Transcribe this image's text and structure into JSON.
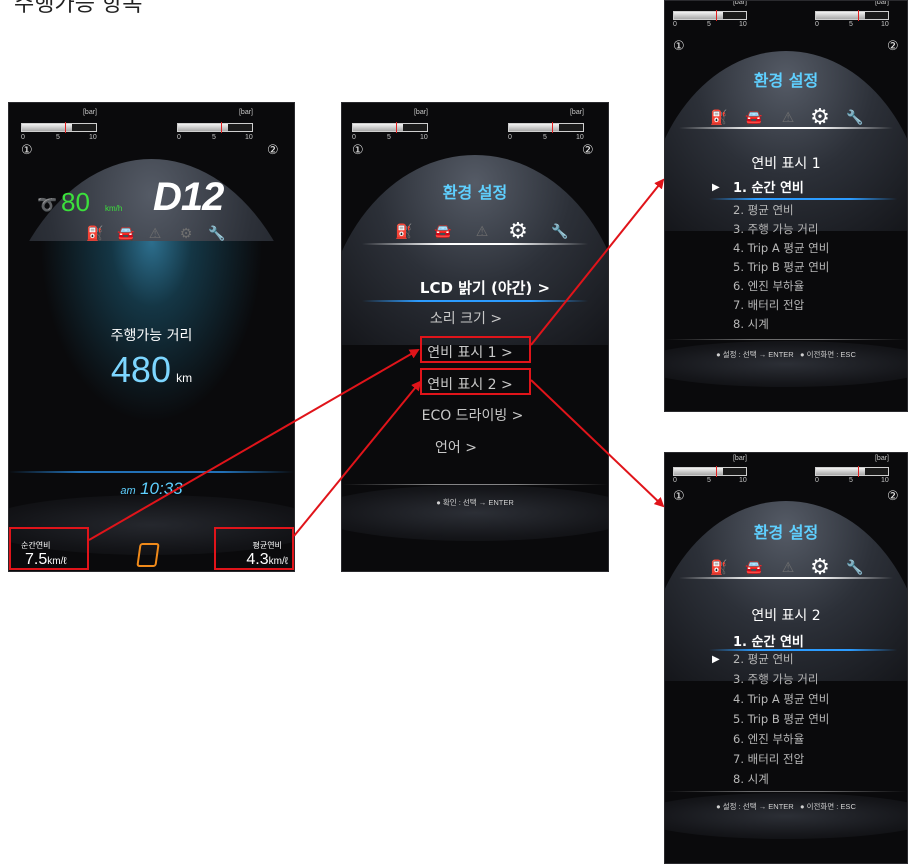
{
  "header_text": "주행가능 항목",
  "gauge": {
    "unit": "[bar]",
    "ticks": [
      "0",
      "5",
      "10"
    ],
    "left_number": "①",
    "right_number": "②",
    "left_fill": 0.68,
    "right_fill": 0.68
  },
  "home_screen": {
    "speed": "80",
    "speed_unit": "km/h",
    "gear": "D12",
    "range_label": "주행가능 거리",
    "range_value": "480",
    "range_unit": "km",
    "time_prefix": "am",
    "time": "10:33",
    "instant_label": "순간연비",
    "instant_value": "7.5",
    "instant_unit": "km/ℓ",
    "average_label": "평균연비",
    "average_value": "4.3",
    "average_unit": "km/ℓ"
  },
  "settings_screen": {
    "title": "환경 설정",
    "items": [
      "LCD 밝기 (야간) >",
      "소리 크기 >",
      "연비 표시 1 >",
      "연비 표시 2 >",
      "ECO 드라이빙 >",
      "언어 >"
    ],
    "footer": "● 확인 : 선택 → ENTER"
  },
  "fuel_display_1": {
    "title": "환경 설정",
    "heading": "연비 표시 1",
    "pointer": "▶",
    "items": [
      "1. 순간 연비",
      "2. 평균 연비",
      "3. 주행 가능 거리",
      "4. Trip A 평균 연비",
      "5. Trip B 평균 연비",
      "6. 엔진 부하율",
      "7. 배터리 전압",
      "8. 시계"
    ],
    "footer_left": "● 설정 : 선택 → ENTER",
    "footer_right": "● 이전화면 : ESC"
  },
  "fuel_display_2": {
    "title": "환경 설정",
    "heading": "연비 표시 2",
    "pointer": "▶",
    "items": [
      "1. 순간 연비",
      "2. 평균 연비",
      "3. 주행 가능 거리",
      "4. Trip A 평균 연비",
      "5. Trip B 평균 연비",
      "6. 엔진 부하율",
      "7. 배터리 전압",
      "8. 시계"
    ],
    "footer_left": "● 설정 : 선택 → ENTER",
    "footer_right": "● 이전화면 : ESC"
  },
  "icons": [
    "fuel-icon",
    "car-icon",
    "warning-icon",
    "gear-icon",
    "wrench-icon"
  ],
  "colors": {
    "title_blue": "#5fd0ff",
    "speed_green": "#3be03b",
    "range_blue": "#7dd6ff",
    "highlight_red": "#e0141a",
    "menu_line_blue": "#2c9cff"
  }
}
